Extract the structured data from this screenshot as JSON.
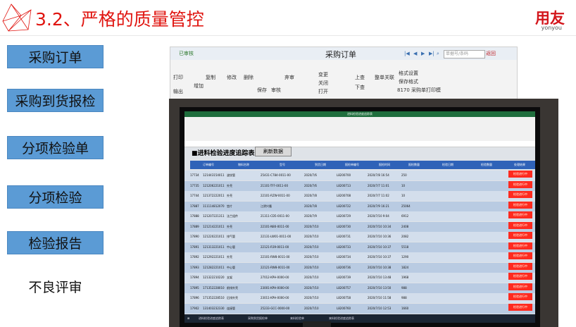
{
  "header": {
    "title": "3.2、严格的质量管控",
    "logo_main": "用友",
    "logo_sub": "yonyou"
  },
  "steps": [
    {
      "label": "采购订单"
    },
    {
      "label": "采购到货报检"
    },
    {
      "label": "分项检验单"
    },
    {
      "label": "分项检验"
    },
    {
      "label": "检验报告"
    },
    {
      "label": "不良评审"
    }
  ],
  "erp": {
    "window_title": "采购订单",
    "approved": "已审核",
    "search_placeholder": "单据号/条码",
    "back": "返回",
    "toolbar": [
      "打印",
      "输出",
      "增加",
      "复制",
      "修改",
      "删除",
      "保存",
      "审核",
      "弃审",
      "变更",
      "关闭",
      "打开",
      "上查",
      "下查",
      "整单关联",
      "格式设置",
      "保存格式",
      "8170 采购单打印模"
    ]
  },
  "monitor": {
    "sheet_title": "进料检验进度追踪表",
    "refresh_button": "刷新数据",
    "columns": [
      "订单编号",
      "物料名称",
      "型号",
      "到货日期",
      "报检单编号",
      "报检时间",
      "报检数量",
      "检验日期",
      "检验数量",
      "处理结果"
    ],
    "rows": [
      {
        "id": "17734",
        "code": "121443154011",
        "name": "波纹管",
        "model": "25431-C784-0011-00",
        "date": "2020/7/6",
        "doc": "L8200700",
        "time": "2020/7/8 16:54",
        "qty": "250",
        "status": "检验进行中"
      },
      {
        "id": "17735",
        "code": "121206221011",
        "name": "外壳",
        "model": "21101-TFF-0011-00",
        "date": "2020/7/6",
        "doc": "L8200713",
        "time": "2020/7/7 11:01",
        "qty": "10",
        "status": "检验进行中"
      },
      {
        "id": "17744",
        "code": "121372222011",
        "name": "外壳",
        "model": "22101-RZW-0011-00",
        "date": "2020/7/8",
        "doc": "L8200708",
        "time": "2020/7/7 11:02",
        "qty": "10",
        "status": "检验进行中"
      },
      {
        "id": "17887",
        "code": "111114812070",
        "name": "垫片",
        "model": "江阴兴隆",
        "date": "2020/7/8",
        "doc": "L8200722",
        "time": "2020/7/9 16:21",
        "qty": "25064",
        "status": "检验进行中"
      },
      {
        "id": "17888",
        "code": "121207221311",
        "name": "法兰组件",
        "model": "21311-CD5-0011-00",
        "date": "2020/7/9",
        "doc": "L8200729",
        "time": "2020/7/10 9:04",
        "qty": "6912",
        "status": "检验进行中"
      },
      {
        "id": "17889",
        "code": "121214221011",
        "name": "外壳",
        "model": "22101-N80-0011-00",
        "date": "2020/7/10",
        "doc": "L8200730",
        "time": "2020/7/10 10:34",
        "qty": "2408",
        "status": "检验进行中"
      },
      {
        "id": "17890",
        "code": "121220221011",
        "name": "排气管",
        "model": "22131-LW01-0011-00",
        "date": "2020/7/10",
        "doc": "L8200731",
        "time": "2020/7/10 10:36",
        "qty": "2082",
        "status": "检验进行中"
      },
      {
        "id": "17891",
        "code": "121313221011",
        "name": "中心管",
        "model": "22121-R39-0011-00",
        "date": "2020/7/10",
        "doc": "L8200733",
        "time": "2020/7/10 10:37",
        "qty": "5518",
        "status": "检验进行中"
      },
      {
        "id": "17892",
        "code": "121292221011",
        "name": "外壳",
        "model": "22101-RW8-0011-00",
        "date": "2020/7/10",
        "doc": "L8200734",
        "time": "2020/7/10 10:37",
        "qty": "1290",
        "status": "检验进行中"
      },
      {
        "id": "17893",
        "code": "121282221011",
        "name": "中心管",
        "model": "22121-RW8-0011-00",
        "date": "2020/7/10",
        "doc": "L8200736",
        "time": "2020/7/10 10:38",
        "qty": "1824",
        "status": "检验进行中"
      },
      {
        "id": "17894",
        "code": "121322210220",
        "name": "支架",
        "model": "27012-KPH-0000-00",
        "date": "2020/7/10",
        "doc": "L8200739",
        "time": "2020/7/10 13:48",
        "qty": "1968",
        "status": "检验进行中"
      },
      {
        "id": "17895",
        "code": "171352228010",
        "name": "前排外壳",
        "model": "23001-KPH-0000-00",
        "date": "2020/7/10",
        "doc": "L8200757",
        "time": "2020/7/10 13:50",
        "qty": "988",
        "status": "检验进行中"
      },
      {
        "id": "17896",
        "code": "171352228510",
        "name": "后排外壳",
        "model": "23011-KPH-0000-00",
        "date": "2020/7/10",
        "doc": "L8200758",
        "time": "2020/7/10 11:58",
        "qty": "988",
        "status": "检验进行中"
      },
      {
        "id": "17902",
        "code": "131403232330",
        "name": "连接管",
        "model": "25233-GCC-0000-00",
        "date": "2020/7/10",
        "doc": "L8200760",
        "time": "2020/7/10 12:53",
        "qty": "1660",
        "status": "检验进行中"
      }
    ],
    "taskbar_items": [
      "进料检验进度追踪表",
      "采购到货报检单",
      "来料检验单",
      "来料检验进度追踪表"
    ]
  },
  "colors": {
    "title_red": "#e0140f",
    "step_blue": "#5b9bd5",
    "header_blue": "#2f62b8",
    "status_red": "#ff2a1f"
  }
}
